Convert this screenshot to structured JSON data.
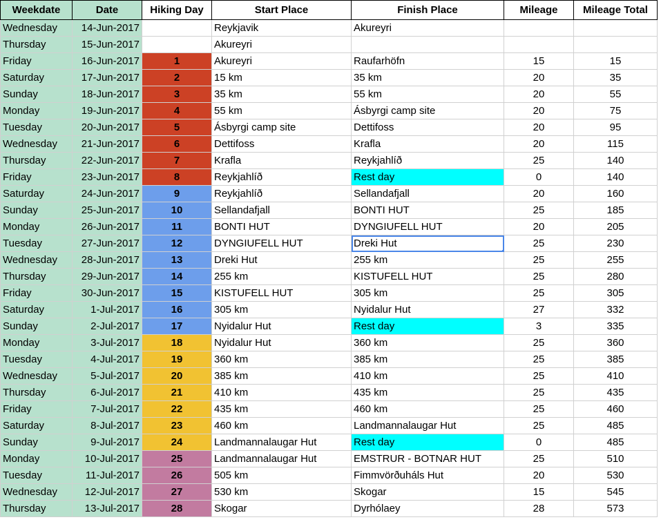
{
  "headers": [
    "Weekdate",
    "Date",
    "Hiking Day",
    "Start Place",
    "Finish Place",
    "Mileage",
    "Mileage Total"
  ],
  "colors": {
    "header_green": "#b7e1cd",
    "red": "#cc4125",
    "blue": "#6d9eeb",
    "yellow": "#f1c232",
    "purple": "#c27ba0",
    "rest": "#00ffff",
    "selection": "#4a86e8"
  },
  "rows": [
    {
      "weekday": "Wednesday",
      "date": "14-Jun-2017",
      "day": "",
      "start": "Reykjavik",
      "finish": "Akureyri",
      "mileage": "",
      "total": "",
      "color": ""
    },
    {
      "weekday": "Thursday",
      "date": "15-Jun-2017",
      "day": "",
      "start": "Akureyri",
      "finish": "",
      "mileage": "",
      "total": "",
      "color": ""
    },
    {
      "weekday": "Friday",
      "date": "16-Jun-2017",
      "day": "1",
      "start": "Akureyri",
      "finish": "Raufarhöfn",
      "mileage": "15",
      "total": "15",
      "color": "red"
    },
    {
      "weekday": "Saturday",
      "date": "17-Jun-2017",
      "day": "2",
      "start": "15 km",
      "finish": "35 km",
      "mileage": "20",
      "total": "35",
      "color": "red"
    },
    {
      "weekday": "Sunday",
      "date": "18-Jun-2017",
      "day": "3",
      "start": "35 km",
      "finish": "55 km",
      "mileage": "20",
      "total": "55",
      "color": "red"
    },
    {
      "weekday": "Monday",
      "date": "19-Jun-2017",
      "day": "4",
      "start": "55 km",
      "finish": "Ásbyrgi camp site",
      "mileage": "20",
      "total": "75",
      "color": "red"
    },
    {
      "weekday": "Tuesday",
      "date": "20-Jun-2017",
      "day": "5",
      "start": "Ásbyrgi camp site",
      "finish": "Dettifoss",
      "mileage": "20",
      "total": "95",
      "color": "red"
    },
    {
      "weekday": "Wednesday",
      "date": "21-Jun-2017",
      "day": "6",
      "start": "Dettifoss",
      "finish": "Krafla",
      "mileage": "20",
      "total": "115",
      "color": "red"
    },
    {
      "weekday": "Thursday",
      "date": "22-Jun-2017",
      "day": "7",
      "start": "Krafla",
      "finish": "Reykjahlíð",
      "mileage": "25",
      "total": "140",
      "color": "red"
    },
    {
      "weekday": "Friday",
      "date": "23-Jun-2017",
      "day": "8",
      "start": "Reykjahlíð",
      "finish": "Rest day",
      "mileage": "0",
      "total": "140",
      "color": "red",
      "rest": true
    },
    {
      "weekday": "Saturday",
      "date": "24-Jun-2017",
      "day": "9",
      "start": "Reykjahlíð",
      "finish": "Sellandafjall",
      "mileage": "20",
      "total": "160",
      "color": "blue"
    },
    {
      "weekday": "Sunday",
      "date": "25-Jun-2017",
      "day": "10",
      "start": "Sellandafjall",
      "finish": "BONTI HUT",
      "mileage": "25",
      "total": "185",
      "color": "blue"
    },
    {
      "weekday": "Monday",
      "date": "26-Jun-2017",
      "day": "11",
      "start": "BONTI HUT",
      "finish": "DYNGIUFELL HUT",
      "mileage": "20",
      "total": "205",
      "color": "blue"
    },
    {
      "weekday": "Tuesday",
      "date": "27-Jun-2017",
      "day": "12",
      "start": "DYNGIUFELL HUT",
      "finish": "Dreki Hut",
      "mileage": "25",
      "total": "230",
      "color": "blue",
      "selected": true
    },
    {
      "weekday": "Wednesday",
      "date": "28-Jun-2017",
      "day": "13",
      "start": "Dreki Hut",
      "finish": "255 km",
      "mileage": "25",
      "total": "255",
      "color": "blue"
    },
    {
      "weekday": "Thursday",
      "date": "29-Jun-2017",
      "day": "14",
      "start": "255 km",
      "finish": "KISTUFELL HUT",
      "mileage": "25",
      "total": "280",
      "color": "blue"
    },
    {
      "weekday": "Friday",
      "date": "30-Jun-2017",
      "day": "15",
      "start": "KISTUFELL HUT",
      "finish": "305 km",
      "mileage": "25",
      "total": "305",
      "color": "blue"
    },
    {
      "weekday": "Saturday",
      "date": "1-Jul-2017",
      "day": "16",
      "start": "305 km",
      "finish": "Nyidalur Hut",
      "mileage": "27",
      "total": "332",
      "color": "blue"
    },
    {
      "weekday": "Sunday",
      "date": "2-Jul-2017",
      "day": "17",
      "start": "Nyidalur Hut",
      "finish": "Rest day",
      "mileage": "3",
      "total": "335",
      "color": "blue",
      "rest": true
    },
    {
      "weekday": "Monday",
      "date": "3-Jul-2017",
      "day": "18",
      "start": "Nyidalur Hut",
      "finish": "360 km",
      "mileage": "25",
      "total": "360",
      "color": "yellow"
    },
    {
      "weekday": "Tuesday",
      "date": "4-Jul-2017",
      "day": "19",
      "start": "360 km",
      "finish": "385 km",
      "mileage": "25",
      "total": "385",
      "color": "yellow"
    },
    {
      "weekday": "Wednesday",
      "date": "5-Jul-2017",
      "day": "20",
      "start": "385 km",
      "finish": "410 km",
      "mileage": "25",
      "total": "410",
      "color": "yellow"
    },
    {
      "weekday": "Thursday",
      "date": "6-Jul-2017",
      "day": "21",
      "start": "410 km",
      "finish": "435 km",
      "mileage": "25",
      "total": "435",
      "color": "yellow"
    },
    {
      "weekday": "Friday",
      "date": "7-Jul-2017",
      "day": "22",
      "start": "435 km",
      "finish": "460 km",
      "mileage": "25",
      "total": "460",
      "color": "yellow"
    },
    {
      "weekday": "Saturday",
      "date": "8-Jul-2017",
      "day": "23",
      "start": "460 km",
      "finish": "Landmannalaugar Hut",
      "mileage": "25",
      "total": "485",
      "color": "yellow"
    },
    {
      "weekday": "Sunday",
      "date": "9-Jul-2017",
      "day": "24",
      "start": "Landmannalaugar Hut",
      "finish": "Rest day",
      "mileage": "0",
      "total": "485",
      "color": "yellow",
      "rest": true
    },
    {
      "weekday": "Monday",
      "date": "10-Jul-2017",
      "day": "25",
      "start": "Landmannalaugar Hut",
      "finish": "EMSTRUR - BOTNAR HUT",
      "mileage": "25",
      "total": "510",
      "color": "purple"
    },
    {
      "weekday": "Tuesday",
      "date": "11-Jul-2017",
      "day": "26",
      "start": "505 km",
      "finish": "Fimmvörðuháls Hut",
      "mileage": "20",
      "total": "530",
      "color": "purple"
    },
    {
      "weekday": "Wednesday",
      "date": "12-Jul-2017",
      "day": "27",
      "start": "530 km",
      "finish": "Skogar",
      "mileage": "15",
      "total": "545",
      "color": "purple"
    },
    {
      "weekday": "Thursday",
      "date": "13-Jul-2017",
      "day": "28",
      "start": "Skogar",
      "finish": "Dyrhólaey",
      "mileage": "28",
      "total": "573",
      "color": "purple"
    }
  ]
}
